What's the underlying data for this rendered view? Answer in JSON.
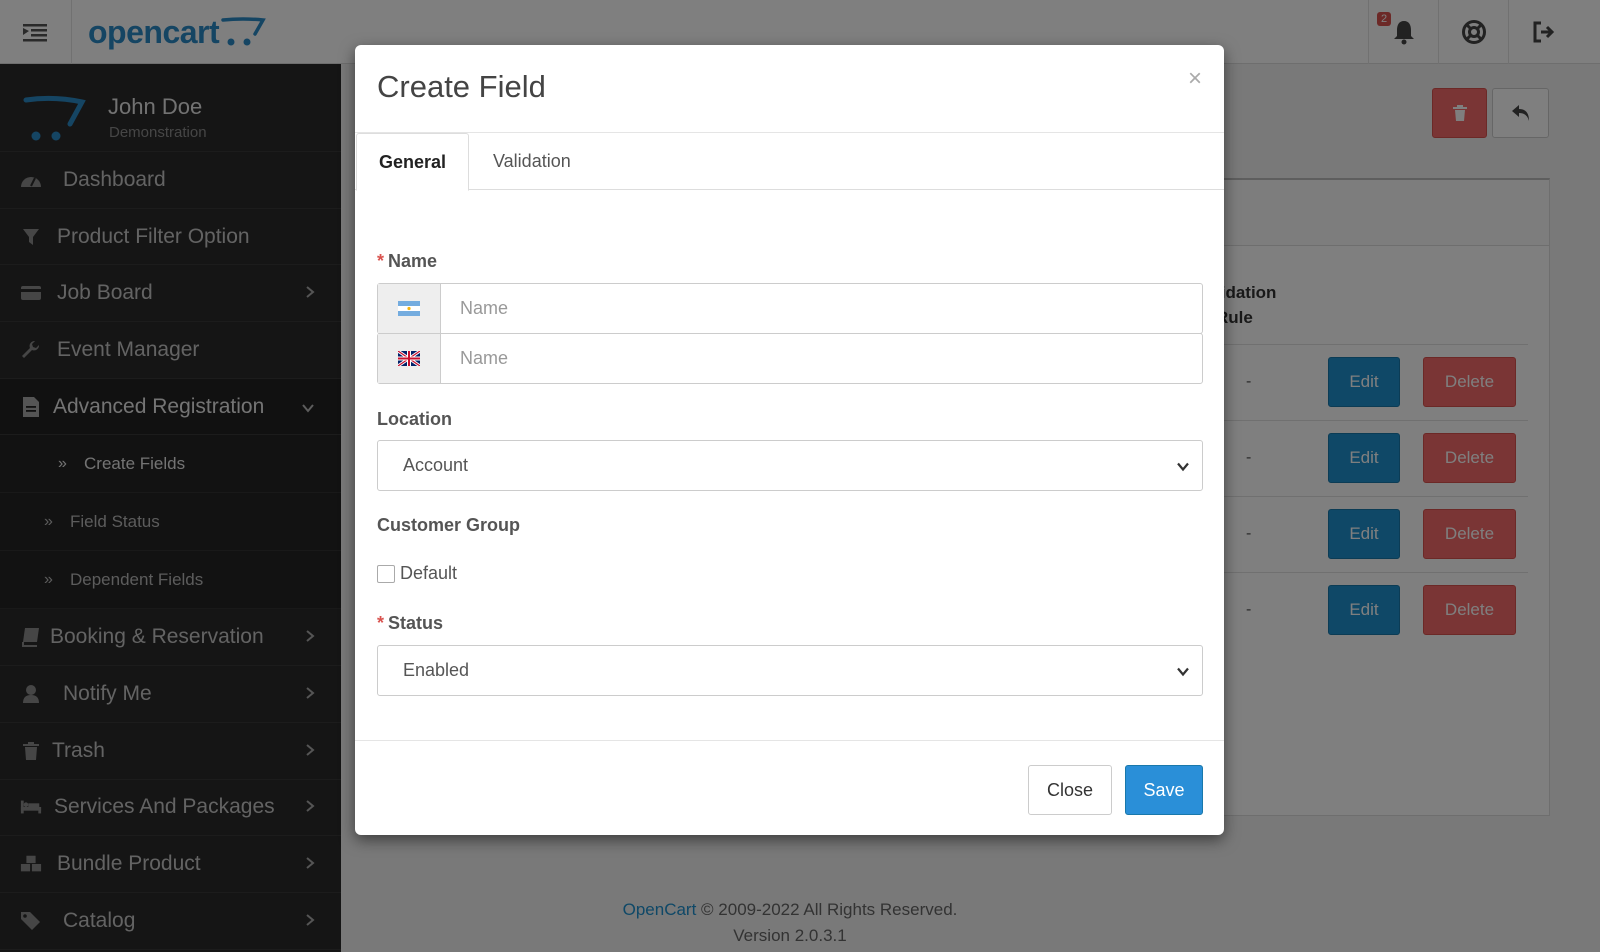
{
  "header": {
    "logo_text": "opencart",
    "notification_count": "2"
  },
  "profile": {
    "name": "John Doe",
    "role": "Demonstration"
  },
  "sidebar": {
    "items": [
      {
        "label": "Dashboard",
        "icon": "dashboard-icon"
      },
      {
        "label": "Product Filter Option",
        "icon": "filter-icon"
      },
      {
        "label": "Job Board",
        "icon": "credit-card-icon"
      },
      {
        "label": "Event Manager",
        "icon": "wrench-icon"
      },
      {
        "label": "Advanced Registration",
        "icon": "file-icon"
      },
      {
        "label": "Booking & Reservation",
        "icon": "book-icon"
      },
      {
        "label": "Notify Me",
        "icon": "user-icon"
      },
      {
        "label": "Trash",
        "icon": "trash-icon"
      },
      {
        "label": "Services And Packages",
        "icon": "bed-icon"
      },
      {
        "label": "Bundle Product",
        "icon": "cubes-icon"
      },
      {
        "label": "Catalog",
        "icon": "tags-icon"
      }
    ],
    "sub_items": [
      {
        "label": "Create Fields"
      },
      {
        "label": "Field Status"
      },
      {
        "label": "Dependent Fields"
      }
    ]
  },
  "background_table": {
    "column_header": "lidation Rule",
    "rows": [
      {
        "value": "-",
        "edit": "Edit",
        "delete": "Delete"
      },
      {
        "value": "-",
        "edit": "Edit",
        "delete": "Delete"
      },
      {
        "value": "-",
        "edit": "Edit",
        "delete": "Delete"
      },
      {
        "value": "-",
        "edit": "Edit",
        "delete": "Delete"
      }
    ]
  },
  "footer": {
    "link": "OpenCart",
    "copyright": "© 2009-2022 All Rights Reserved.",
    "version": "Version 2.0.3.1"
  },
  "modal": {
    "title": "Create Field",
    "close_symbol": "×",
    "tabs": [
      {
        "label": "General",
        "active": true
      },
      {
        "label": "Validation",
        "active": false
      }
    ],
    "name_label": "Name",
    "name_placeholder_1": "Name",
    "name_placeholder_2": "Name",
    "location_label": "Location",
    "location_value": "Account",
    "customer_group_label": "Customer Group",
    "customer_group_option": "Default",
    "status_label": "Status",
    "status_value": "Enabled",
    "close_button": "Close",
    "save_button": "Save"
  },
  "colors": {
    "primary": "#1e91cf",
    "danger": "#f56b6b",
    "sidebar_bg": "#2b2b2b",
    "required": "#d9534f"
  }
}
